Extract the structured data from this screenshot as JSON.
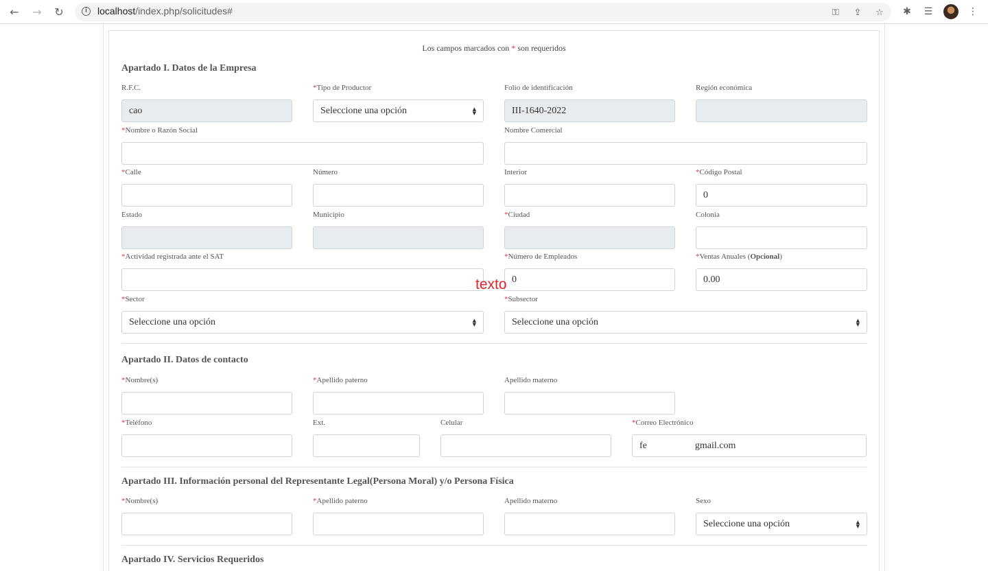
{
  "browser": {
    "back_icon": "←",
    "forward_icon": "→",
    "reload_icon": "↻",
    "url_host": "localhost",
    "url_path": "/index.php/solicitudes#",
    "key_icon": "⚿",
    "share_icon": "⇪",
    "star_icon": "☆",
    "extensions_icon": "✱",
    "readinglist_icon": "☰",
    "menu_icon": "⋮"
  },
  "form": {
    "required_note_pre": "Los campos marcados con ",
    "required_mark": "*",
    "required_note_post": " son requeridos",
    "select_placeholder": "Seleccione una opción",
    "section1": {
      "title": "Apartado I. Datos de la Empresa",
      "rfc_label": "R.F.C.",
      "rfc_value": "cao",
      "tipo_label": "Tipo de Productor",
      "folio_label": "Folio de identificación",
      "folio_value": "III-1640-2022",
      "region_label": "Región económica",
      "region_value": "",
      "nombre_label": "Nombre o Razón Social",
      "comercial_label": "Nombre Comercial",
      "calle_label": "Calle",
      "numero_label": "Número",
      "interior_label": "Interior",
      "cp_label": "Código Postal",
      "cp_value": "0",
      "estado_label": "Estado",
      "municipio_label": "Municipio",
      "ciudad_label": "Ciudad",
      "colonia_label": "Colonia",
      "actividad_label": "Actividad registrada ante el SAT",
      "empleados_label": "Número de Empleados",
      "empleados_value": "0",
      "ventas_label_pre": "Ventas Anuales (",
      "ventas_label_bold": "Opcional",
      "ventas_label_post": ")",
      "ventas_value": "0.00",
      "sector_label": "Sector",
      "subsector_label": "Subsector"
    },
    "section2": {
      "title": "Apartado II. Datos de contacto",
      "nombres_label": "Nombre(s)",
      "paterno_label": "Apellido paterno",
      "materno_label": "Apellido materno",
      "telefono_label": "Teléfono",
      "ext_label": "Ext.",
      "celular_label": "Celular",
      "correo_label": "Correo Electrónico",
      "correo_value_start": "fe",
      "correo_value_end": "gmail.com"
    },
    "section3": {
      "title": "Apartado III. Información personal del Representante Legal(Persona Moral) y/o Persona Física",
      "nombres_label": "Nombre(s)",
      "paterno_label": "Apellido paterno",
      "materno_label": "Apellido materno",
      "sexo_label": "Sexo"
    },
    "section4": {
      "title": "Apartado IV. Servicios Requeridos"
    }
  },
  "overlay_text": "texto"
}
